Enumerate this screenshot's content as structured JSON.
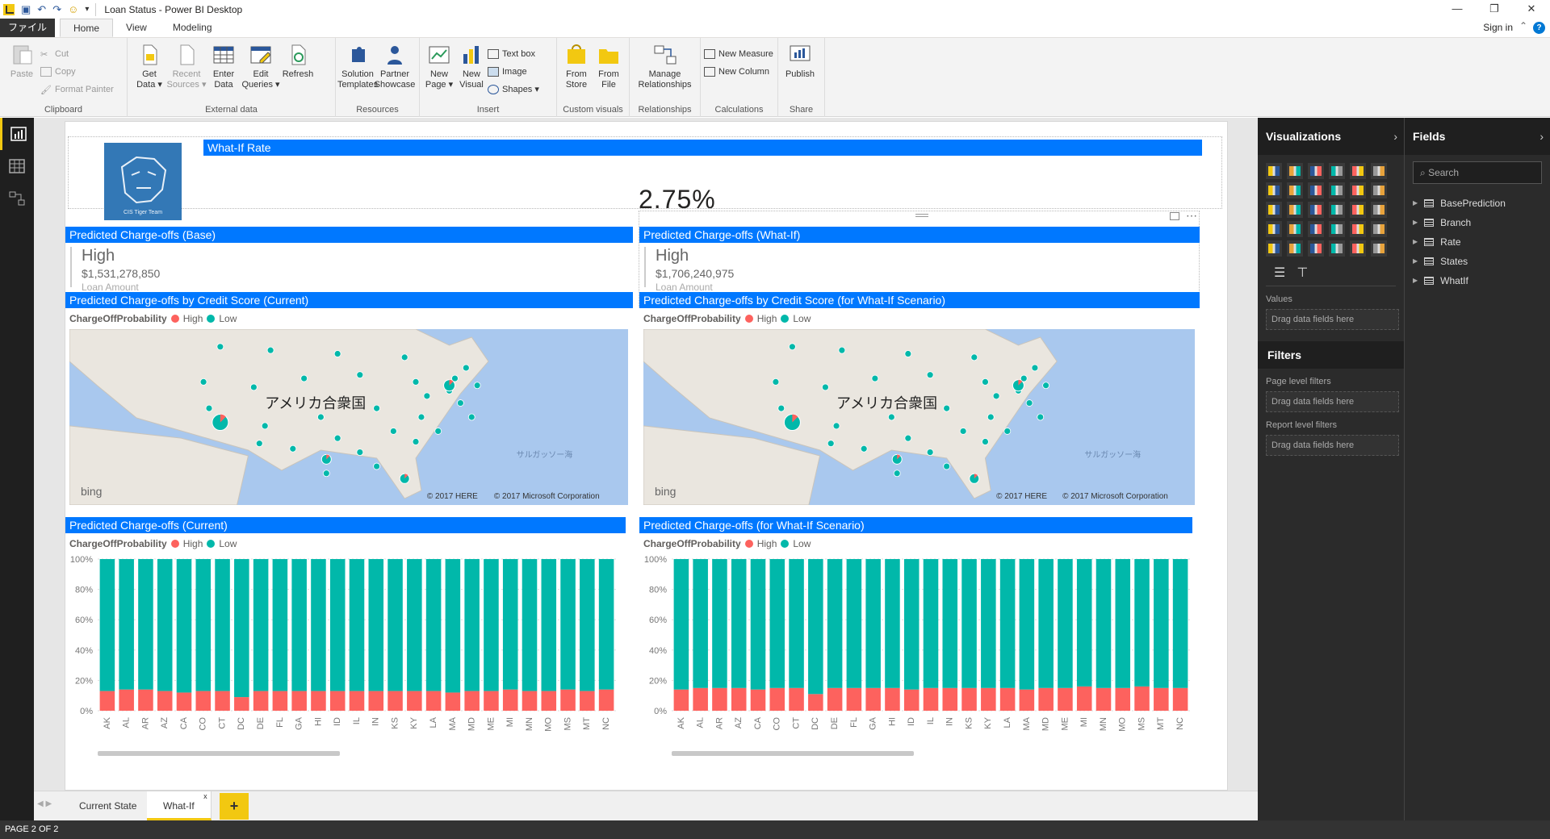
{
  "app": {
    "title": "Loan Status - Power BI Desktop",
    "signin": "Sign in"
  },
  "ribbon_tabs": [
    "ファイル",
    "Home",
    "View",
    "Modeling"
  ],
  "ribbon": {
    "clipboard": {
      "label": "Clipboard",
      "paste": "Paste",
      "cut": "Cut",
      "copy": "Copy",
      "format_painter": "Format Painter"
    },
    "external": {
      "label": "External data",
      "get_data": "Get\nData ▾",
      "recent_sources": "Recent\nSources ▾",
      "enter_data": "Enter\nData",
      "edit_queries": "Edit\nQueries ▾",
      "refresh": "Refresh"
    },
    "resources": {
      "label": "Resources",
      "solution_templates": "Solution\nTemplates",
      "partner_showcase": "Partner\nShowcase"
    },
    "insert": {
      "label": "Insert",
      "new_page": "New\nPage ▾",
      "new_visual": "New\nVisual",
      "text_box": "Text box",
      "image": "Image",
      "shapes": "Shapes ▾"
    },
    "custom_visuals": {
      "label": "Custom visuals",
      "from_store": "From\nStore",
      "from_file": "From\nFile"
    },
    "relationships": {
      "label": "Relationships",
      "manage": "Manage\nRelationships"
    },
    "calculations": {
      "label": "Calculations",
      "new_measure": "New Measure",
      "new_column": "New Column"
    },
    "share": {
      "label": "Share",
      "publish": "Publish"
    }
  },
  "report": {
    "logo_text": "CIS Tiger Team",
    "whatif_header": "What-If Rate",
    "whatif_value": "2.75%",
    "card_base": {
      "header": "Predicted Charge-offs (Base)",
      "label": "High",
      "value": "$1,531,278,850",
      "sub": "Loan Amount"
    },
    "card_whatif": {
      "header": "Predicted Charge-offs (What-If)",
      "label": "High",
      "value": "$1,706,240,975",
      "sub": "Loan Amount"
    },
    "map_current_header": "Predicted Charge-offs by Credit Score (Current)",
    "map_whatif_header": "Predicted Charge-offs by Credit Score (for What-If Scenario)",
    "bar_current_header": "Predicted Charge-offs (Current)",
    "bar_whatif_header": "Predicted Charge-offs (for What-If Scenario)",
    "legend": {
      "title": "ChargeOffProbability",
      "high": "High",
      "low": "Low",
      "high_color": "#fd625e",
      "low_color": "#01b8aa"
    },
    "map_labels": {
      "country": "アメリカ合衆国",
      "sea": "サルガッソー海",
      "bing": "bing",
      "here": "© 2017 HERE",
      "ms": "© 2017 Microsoft Corporation"
    }
  },
  "chart_data": [
    {
      "type": "bar",
      "title": "Predicted Charge-offs (Current)",
      "stacked": "100%",
      "categories": [
        "AK",
        "AL",
        "AR",
        "AZ",
        "CA",
        "CO",
        "CT",
        "DC",
        "DE",
        "FL",
        "GA",
        "HI",
        "ID",
        "IL",
        "IN",
        "KS",
        "KY",
        "LA",
        "MA",
        "MD",
        "ME",
        "MI",
        "MN",
        "MO",
        "MS",
        "MT",
        "NC"
      ],
      "series": [
        {
          "name": "High",
          "values": [
            13,
            14,
            14,
            13,
            12,
            13,
            13,
            9,
            13,
            13,
            13,
            13,
            13,
            13,
            13,
            13,
            13,
            13,
            12,
            13,
            13,
            14,
            13,
            13,
            14,
            13,
            14
          ]
        },
        {
          "name": "Low",
          "values": [
            87,
            86,
            86,
            87,
            88,
            87,
            87,
            91,
            87,
            87,
            87,
            87,
            87,
            87,
            87,
            87,
            87,
            87,
            88,
            87,
            87,
            86,
            87,
            87,
            86,
            87,
            86
          ]
        }
      ],
      "ylim": [
        0,
        100
      ],
      "yticks": [
        "0%",
        "20%",
        "40%",
        "60%",
        "80%",
        "100%"
      ]
    },
    {
      "type": "bar",
      "title": "Predicted Charge-offs (for What-If Scenario)",
      "stacked": "100%",
      "categories": [
        "AK",
        "AL",
        "AR",
        "AZ",
        "CA",
        "CO",
        "CT",
        "DC",
        "DE",
        "FL",
        "GA",
        "HI",
        "ID",
        "IL",
        "IN",
        "KS",
        "KY",
        "LA",
        "MA",
        "MD",
        "ME",
        "MI",
        "MN",
        "MO",
        "MS",
        "MT",
        "NC"
      ],
      "series": [
        {
          "name": "High",
          "values": [
            14,
            15,
            15,
            15,
            14,
            15,
            15,
            11,
            15,
            15,
            15,
            15,
            14,
            15,
            15,
            15,
            15,
            15,
            14,
            15,
            15,
            16,
            15,
            15,
            16,
            15,
            15
          ]
        },
        {
          "name": "Low",
          "values": [
            86,
            85,
            85,
            85,
            86,
            85,
            85,
            89,
            85,
            85,
            85,
            85,
            86,
            85,
            85,
            85,
            85,
            85,
            86,
            85,
            85,
            84,
            85,
            85,
            84,
            85,
            85
          ]
        }
      ],
      "ylim": [
        0,
        100
      ],
      "yticks": [
        "0%",
        "20%",
        "40%",
        "60%",
        "80%",
        "100%"
      ]
    }
  ],
  "page_tabs": [
    "Current State",
    "What-If"
  ],
  "status": "PAGE 2 OF 2",
  "viz_pane": {
    "title": "Visualizations",
    "values_label": "Values",
    "drag_here": "Drag data fields here",
    "filters_title": "Filters",
    "page_filters": "Page level filters",
    "report_filters": "Report level filters"
  },
  "fields_pane": {
    "title": "Fields",
    "search_placeholder": "Search",
    "tables": [
      "BasePrediction",
      "Branch",
      "Rate",
      "States",
      "WhatIf"
    ]
  }
}
